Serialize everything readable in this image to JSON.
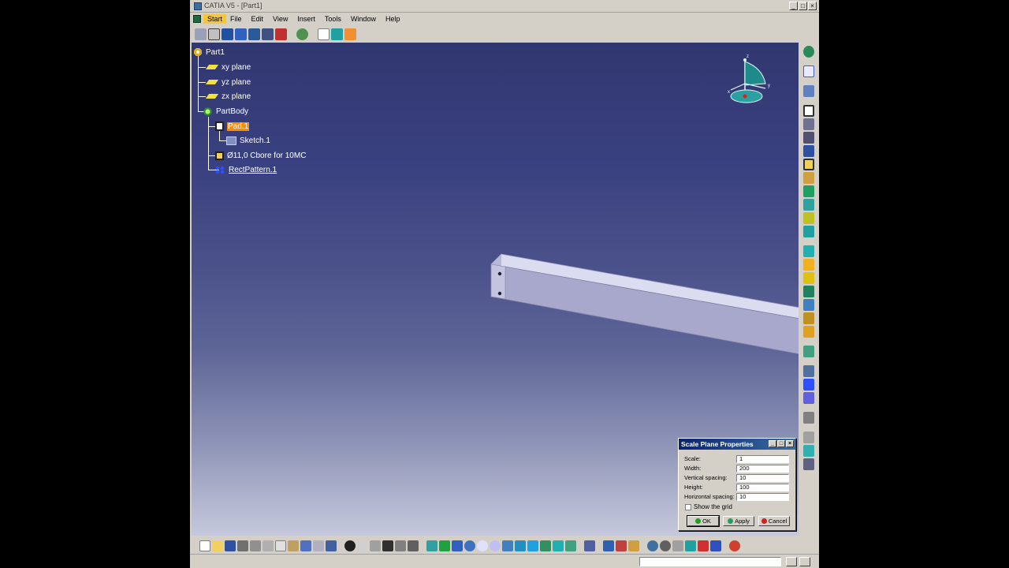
{
  "window": {
    "title": "CATIA V5 - [Part1]",
    "controls": [
      "_",
      "□",
      "×"
    ]
  },
  "menu": {
    "items": [
      "Start",
      "File",
      "Edit",
      "View",
      "Insert",
      "Tools",
      "Window",
      "Help"
    ],
    "active": "Start"
  },
  "tree": {
    "root": "Part1",
    "planes": [
      "xy plane",
      "yz plane",
      "zx plane"
    ],
    "body": "PartBody",
    "pad": "Pad.1",
    "sketch": "Sketch.1",
    "hole": "Ø11,0 Cbore for 10MC",
    "pattern": "RectPattern.1"
  },
  "compass": {
    "axis_x": "x",
    "axis_y": "y",
    "axis_z": "z"
  },
  "dialog": {
    "title": "Scale Plane Properties",
    "fields": [
      {
        "label": "Scale:",
        "value": "1"
      },
      {
        "label": "Width:",
        "value": "200"
      },
      {
        "label": "Vertical spacing:",
        "value": "10"
      },
      {
        "label": "Height:",
        "value": "100"
      },
      {
        "label": "Horizontal spacing:",
        "value": "10"
      }
    ],
    "checkbox_label": "Show the grid",
    "checkbox_checked": false,
    "ok_label": "OK",
    "apply_label": "Apply",
    "cancel_label": "Cancel"
  },
  "colors": {
    "selection": "#ff8c00",
    "viewport_top": "#303770",
    "viewport_bottom": "#c6c9dc",
    "ok": "#20a020",
    "cancel": "#d02020"
  }
}
